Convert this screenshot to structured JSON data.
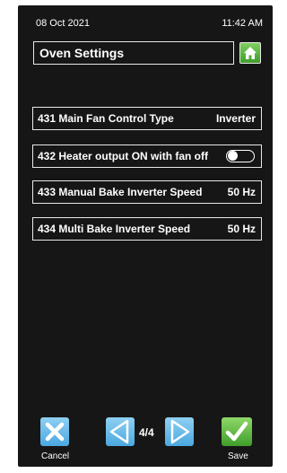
{
  "status": {
    "date": "08 Oct 2021",
    "time": "11:42 AM"
  },
  "header": {
    "title": "Oven Settings"
  },
  "settings": [
    {
      "label": "431 Main Fan Control Type",
      "value": "Inverter"
    },
    {
      "label": "432 Heater output ON with fan off",
      "toggle": "off"
    },
    {
      "label": "433 Manual Bake Inverter Speed",
      "value": "50 Hz"
    },
    {
      "label": "434 Multi Bake Inverter Speed",
      "value": "50 Hz"
    }
  ],
  "footer": {
    "cancel_label": "Cancel",
    "page_indicator": "4/4",
    "save_label": "Save"
  },
  "icons": {
    "home": "home-icon",
    "cancel": "close-x-icon",
    "prev": "triangle-left-icon",
    "next": "triangle-right-icon",
    "save": "checkmark-icon"
  },
  "colors": {
    "background": "#161616",
    "accent_green": "#3f9e2a",
    "accent_blue": "#4aa8df"
  }
}
